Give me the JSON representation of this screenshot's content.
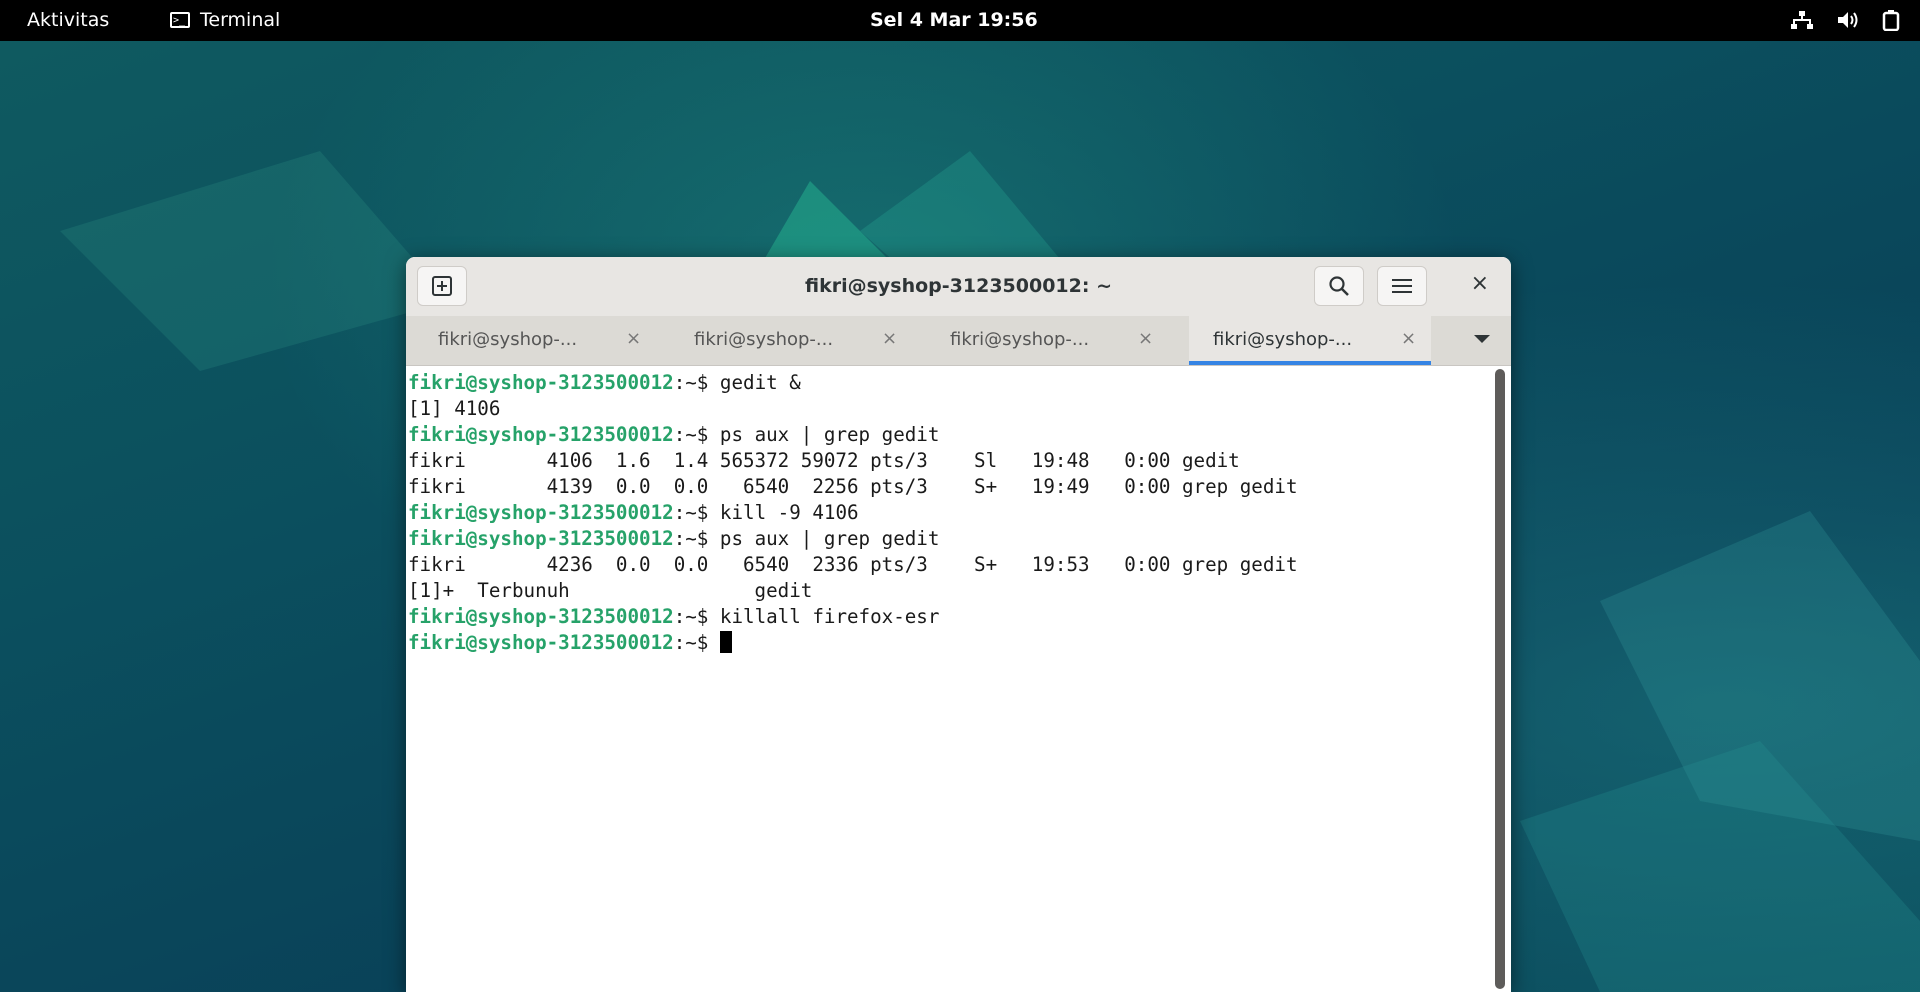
{
  "topbar": {
    "activities": "Aktivitas",
    "app_name": "Terminal",
    "clock": "Sel  4 Mar 19:56",
    "tray_icons": [
      "network-icon",
      "volume-icon",
      "battery-icon"
    ]
  },
  "window": {
    "title": "fikri@syshop-3123500012: ~",
    "tabs": [
      {
        "label": "fikri@syshop-..."
      },
      {
        "label": "fikri@syshop-..."
      },
      {
        "label": "fikri@syshop-..."
      },
      {
        "label": "fikri@syshop-..."
      }
    ],
    "close_symbol": "×"
  },
  "terminal": {
    "prompt": "fikri@syshop-3123500012",
    "prompt_suffix": ":~$ ",
    "lines": [
      {
        "type": "cmd",
        "text": "gedit &"
      },
      {
        "type": "out",
        "text": "[1] 4106"
      },
      {
        "type": "cmd",
        "text": "ps aux | grep gedit"
      },
      {
        "type": "out",
        "text": "fikri       4106  1.6  1.4 565372 59072 pts/3    Sl   19:48   0:00 gedit"
      },
      {
        "type": "out",
        "text": "fikri       4139  0.0  0.0   6540  2256 pts/3    S+   19:49   0:00 grep gedit"
      },
      {
        "type": "cmd",
        "text": "kill -9 4106"
      },
      {
        "type": "cmd",
        "text": "ps aux | grep gedit"
      },
      {
        "type": "out",
        "text": "fikri       4236  0.0  0.0   6540  2336 pts/3    S+   19:53   0:00 grep gedit"
      },
      {
        "type": "out",
        "text": "[1]+  Terbunuh                gedit"
      },
      {
        "type": "cmd",
        "text": "killall firefox-esr"
      },
      {
        "type": "cmd",
        "text": ""
      }
    ]
  }
}
